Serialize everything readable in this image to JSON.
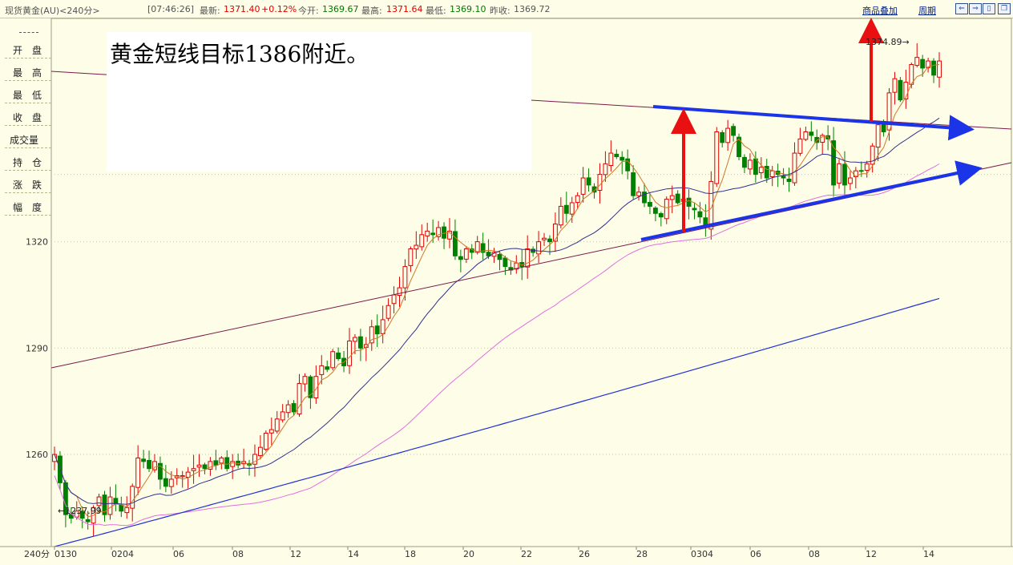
{
  "header": {
    "instrument": "现货黄金(AU)<240分>",
    "time": "[07:46:26]",
    "last_label": "最新:",
    "last_value": "1371.40",
    "change": "+0.12%",
    "open_label": "今开:",
    "open_value": "1369.67",
    "high_label": "最高:",
    "high_value": "1371.64",
    "low_label": "最低:",
    "low_value": "1369.10",
    "prev_label": "昨收:",
    "prev_value": "1369.72",
    "overlay_link": "商品叠加",
    "period_link": "周期"
  },
  "left_panel": {
    "items": [
      "开　盘",
      "最　高",
      "最　低",
      "收　盘",
      "成交量",
      "持　仓",
      "涨　跌",
      "幅　度"
    ]
  },
  "annotation": "黄金短线目标1386附近。",
  "colors": {
    "up": "#e00000",
    "down": "#008000",
    "ma_fast": "#d07828",
    "ma_mid": "#303090",
    "ma_slow": "#e070e0",
    "ma_long": "#2030d0",
    "trendline": "#7a1a4a",
    "arrow_blue": "#1c34e8",
    "arrow_red": "#e81010"
  },
  "chart_data": {
    "type": "candlestick",
    "period_label": "240分",
    "x_ticks": [
      "0130",
      "0204",
      "06",
      "08",
      "12",
      "14",
      "18",
      "20",
      "22",
      "26",
      "28",
      "0304",
      "06",
      "08",
      "12",
      "14"
    ],
    "y_ticks": [
      1260,
      1290,
      1320
    ],
    "y_range": [
      1234,
      1383
    ],
    "max_marker": "1374.89",
    "min_marker": "1237.99",
    "candles_close": [
      1260,
      1252,
      1243,
      1242,
      1244,
      1242,
      1241,
      1245,
      1248,
      1243,
      1248,
      1246,
      1244,
      1245,
      1251,
      1259,
      1258,
      1256,
      1258,
      1253,
      1251,
      1253,
      1254,
      1254,
      1255,
      1256,
      1257,
      1256,
      1258,
      1257,
      1259,
      1256,
      1258,
      1257,
      1258,
      1257,
      1260,
      1262,
      1266,
      1267,
      1270,
      1272,
      1274,
      1272,
      1280,
      1282,
      1276,
      1282,
      1285,
      1284,
      1289,
      1287,
      1285,
      1292,
      1293,
      1290,
      1291,
      1296,
      1294,
      1298,
      1302,
      1305,
      1307,
      1313,
      1318,
      1319,
      1322,
      1323,
      1322,
      1324,
      1321,
      1323,
      1316,
      1315,
      1318,
      1317,
      1320,
      1317,
      1316,
      1317,
      1315,
      1313,
      1312,
      1314,
      1313,
      1318,
      1317,
      1320,
      1321,
      1320,
      1325,
      1330,
      1328,
      1331,
      1333,
      1338,
      1336,
      1334,
      1339,
      1342,
      1345,
      1344,
      1343,
      1340,
      1333,
      1334,
      1331,
      1330,
      1328,
      1327,
      1332,
      1333,
      1331,
      1332,
      1330,
      1329,
      1327,
      1324,
      1337,
      1351,
      1348,
      1352,
      1350,
      1344,
      1341,
      1343,
      1339,
      1341,
      1338,
      1340,
      1339,
      1338,
      1337,
      1345,
      1349,
      1351,
      1350,
      1348,
      1350,
      1349,
      1336,
      1342,
      1336,
      1338,
      1340,
      1340,
      1342,
      1347,
      1353,
      1351,
      1362,
      1366,
      1360,
      1365,
      1370,
      1372,
      1369,
      1371,
      1367,
      1371
    ]
  }
}
